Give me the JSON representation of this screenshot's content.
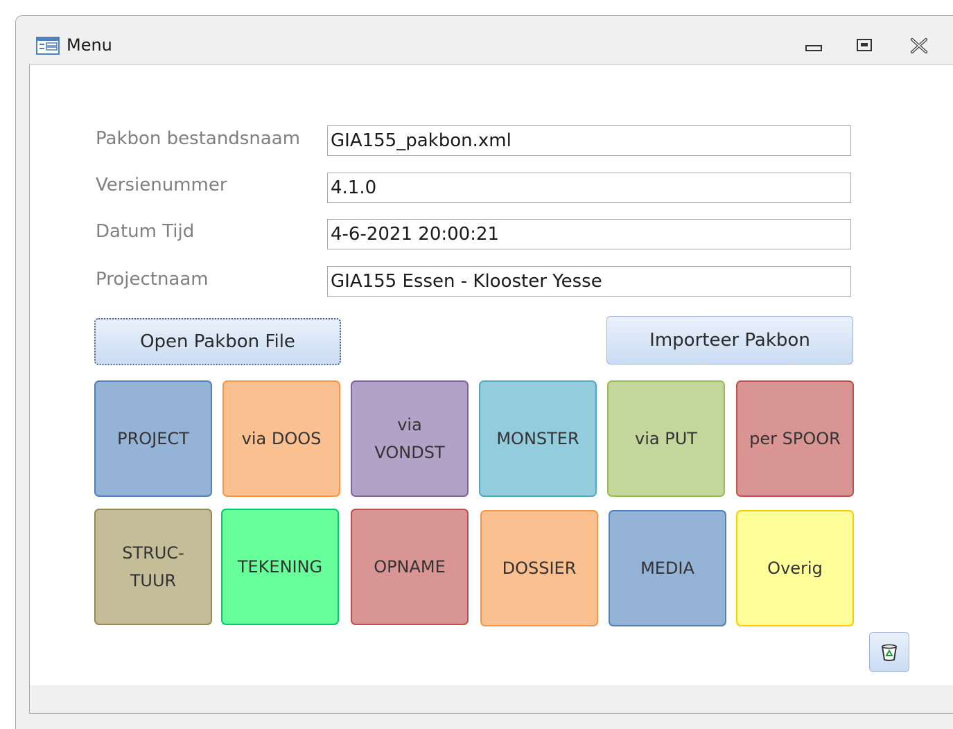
{
  "window": {
    "title": "Menu"
  },
  "form": {
    "fields": [
      {
        "label": "Pakbon bestandsnaam",
        "value": "GIA155_pakbon.xml"
      },
      {
        "label": "Versienummer",
        "value": "4.1.0"
      },
      {
        "label": "Datum Tijd",
        "value": "4-6-2021 20:00:21"
      },
      {
        "label": "Projectnaam",
        "value": "GIA155 Essen - Klooster Yesse"
      }
    ],
    "open_button": "Open Pakbon File",
    "import_button": "Importeer Pakbon"
  },
  "tiles": [
    {
      "label": "PROJECT",
      "color": "#95b3d7",
      "border": "#4f81bd"
    },
    {
      "label": "via DOOS",
      "color": "#fac090",
      "border": "#f79646"
    },
    {
      "label": "via\nVONDST",
      "color": "#b3a2c7",
      "border": "#8064a2"
    },
    {
      "label": "MONSTER",
      "color": "#93cddd",
      "border": "#4bacc6"
    },
    {
      "label": "via PUT",
      "color": "#c3d69b",
      "border": "#9bbb59"
    },
    {
      "label": "per SPOOR",
      "color": "#d99594",
      "border": "#c0504d"
    },
    {
      "label": "STRUC-\nTUUR",
      "color": "#c4bd97",
      "border": "#948a54"
    },
    {
      "label": "TEKENING",
      "color": "#66ff99",
      "border": "#00cc66"
    },
    {
      "label": "OPNAME",
      "color": "#d99594",
      "border": "#c0504d"
    },
    {
      "label": "DOSSIER",
      "color": "#fac090",
      "border": "#f79646"
    },
    {
      "label": "MEDIA",
      "color": "#95b3d7",
      "border": "#4f81bd"
    },
    {
      "label": "Overig",
      "color": "#ffff99",
      "border": "#ffcc00"
    }
  ],
  "icons": {
    "app": "form-icon",
    "minimize": "minimize-icon",
    "restore": "restore-icon",
    "close": "close-icon",
    "trash": "recycle-bin-icon"
  }
}
